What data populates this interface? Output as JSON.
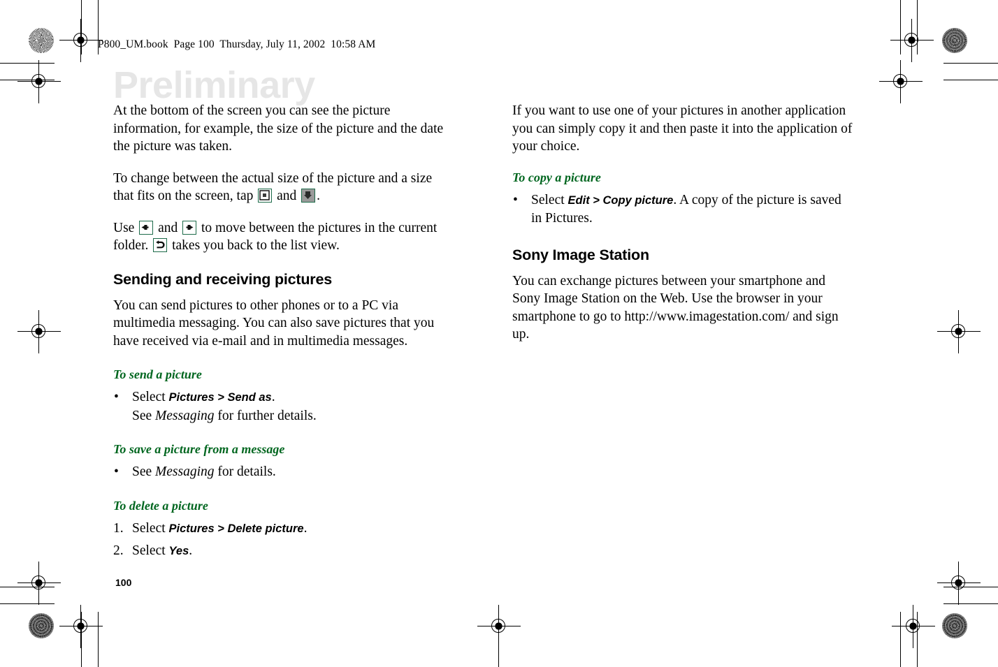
{
  "page": {
    "file_header": "P800_UM.book  Page 100  Thursday, July 11, 2002  10:58 AM",
    "watermark": "Preliminary",
    "page_number": "100",
    "accent_green": "#00661f",
    "icon_border_green": "#1d6b4a"
  },
  "left_column": {
    "paragraph_1": "At the bottom of the screen you can see the picture information, for example, the size of the picture and the date the picture was taken.",
    "paragraph_2_before": "To change between the actual size of the picture and a size that fits on the screen, tap ",
    "paragraph_2_middle": " and ",
    "paragraph_2_after": ".",
    "paragraph_3_before": "Use ",
    "paragraph_3_mid1": " and ",
    "paragraph_3_mid2": " to move between the pictures in the current folder. ",
    "paragraph_3_after": " takes you back to the list view.",
    "section_heading": "Sending and receiving pictures",
    "section_body": "You can send pictures to other phones or to a PC via multimedia messaging. You can also save pictures that you have received via e-mail and in multimedia messages.",
    "task_send": {
      "heading": "To send a picture",
      "bullet_marker": "•",
      "line1_prefix": "Select ",
      "line1_path": "Pictures > Send as",
      "line1_suffix": ".",
      "line2_prefix": "See ",
      "line2_italic": "Messaging",
      "line2_suffix": " for further details."
    },
    "task_save": {
      "heading": "To save a picture from a message",
      "bullet_marker": "•",
      "line1_prefix": "See ",
      "line1_italic": "Messaging",
      "line1_suffix": " for details."
    },
    "task_delete": {
      "heading": "To delete a picture",
      "step1_marker": "1.",
      "step1_prefix": "Select ",
      "step1_path": "Pictures > Delete picture",
      "step1_suffix": ".",
      "step2_marker": "2.",
      "step2_prefix": "Select ",
      "step2_path": "Yes",
      "step2_suffix": "."
    }
  },
  "right_column": {
    "paragraph_1": "If you want to use one of your pictures in another application you can simply copy it and then paste it into the application of your choice.",
    "task_copy": {
      "heading": "To copy a picture",
      "bullet_marker": "•",
      "line1_prefix": "Select ",
      "line1_path": "Edit > Copy picture",
      "line1_suffix": ". A copy of the picture is saved in Pictures."
    },
    "section_heading": "Sony Image Station",
    "section_body": "You can exchange pictures between your smartphone and Sony Image Station on the Web. Use the browser in your smartphone to go to http://www.imagestation.com/ and sign up."
  },
  "icons": {
    "actual_size": "actual-size-icon",
    "fit_screen": "fit-to-screen-icon",
    "previous": "arrow-left-icon",
    "next": "arrow-right-icon",
    "back": "back-arrow-icon"
  }
}
